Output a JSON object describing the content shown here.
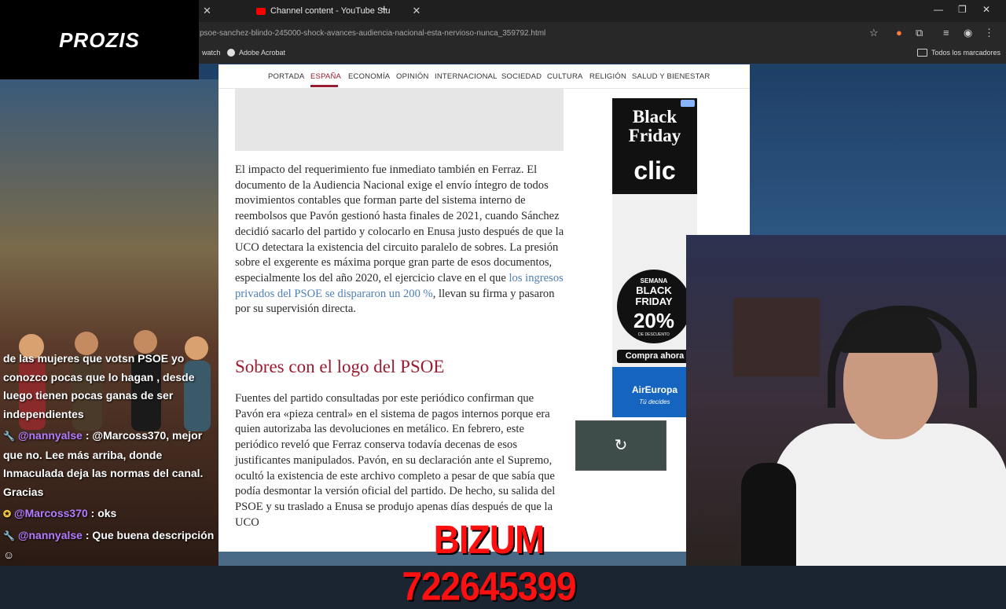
{
  "browser": {
    "tab_active_label": "Channel content - YouTube Stu",
    "url": "psoe-sanchez-blindo-245000-shock-avances-audiencia-nacional-esta-nervioso-nunca_359792.html",
    "bookmarks": [
      "watch",
      "Adobe Acrobat"
    ],
    "all_bookmarks": "Todos los marcadores"
  },
  "nav": {
    "items": [
      "PORTADA",
      "ESPAÑA",
      "ECONOMÍA",
      "OPINIÓN",
      "INTERNACIONAL",
      "SOCIEDAD",
      "CULTURA",
      "RELIGIÓN",
      "SALUD Y BIENESTAR"
    ],
    "active": "ESPAÑA"
  },
  "article": {
    "para1_before_link": "El impacto del requerimiento fue inmediato también en Ferraz. El documento de la Audiencia Nacional exige el envío íntegro de todos movimientos contables que forman parte del sistema interno de reembolsos que Pavón gestionó hasta finales de 2021, cuando Sánchez decidió sacarlo del partido y colocarlo en Enusa justo después de que la UCO detectara la existencia del circuito paralelo de sobres. La presión sobre el exgerente es máxima porque gran parte de esos documentos, especialmente los del año 2020, el ejercicio clave en el que ",
    "para1_link": "los ingresos privados del PSOE se dispararon un 200 %",
    "para1_after_link": ", llevan su firma y pasaron por su supervisión directa.",
    "heading": "Sobres con el logo del PSOE",
    "para2": "Fuentes del partido consultadas por este periódico confirman que Pavón era «pieza central» en el sistema de pagos internos porque era quien autorizaba las devoluciones en metálico. En febrero, este periódico reveló que Ferraz conserva todavía decenas de esos justificantes manipulados. Pavón, en su declaración ante el Supremo, ocultó la existencia de este archivo completo a pesar de que sabía que podía desmontar la versión oficial del partido. De hecho, su salida del PSOE y su traslado a Enusa se produjo apenas días después de que la UCO"
  },
  "ad": {
    "title": "Black Friday",
    "brand": "clic",
    "badge_top": "SEMANA",
    "badge_main": "BLACK FRIDAY",
    "badge_pct": "20%",
    "badge_small": "DE DESCUENTO",
    "hasta": "HASTA",
    "cta": "Compra ahora",
    "airline": "AirEuropa",
    "tagline": "Tú decides"
  },
  "stream": {
    "logo": "PROZIS",
    "bizum": "BIZUM 722645399",
    "chat": [
      {
        "user": "",
        "text": "de las mujeres que votsn PSOE yo conozco pocas que lo hagan , desde luego tienen pocas ganas de ser independientes"
      },
      {
        "user": "@nannyalse",
        "text": " : @Marcoss370, mejor que no. Lee más arriba, donde Inmaculada deja las normas del canal. Gracias"
      },
      {
        "user": "@Marcoss370",
        "text": " : oks"
      },
      {
        "user": "@nannyalse",
        "text": " : Que buena descripción"
      }
    ]
  }
}
